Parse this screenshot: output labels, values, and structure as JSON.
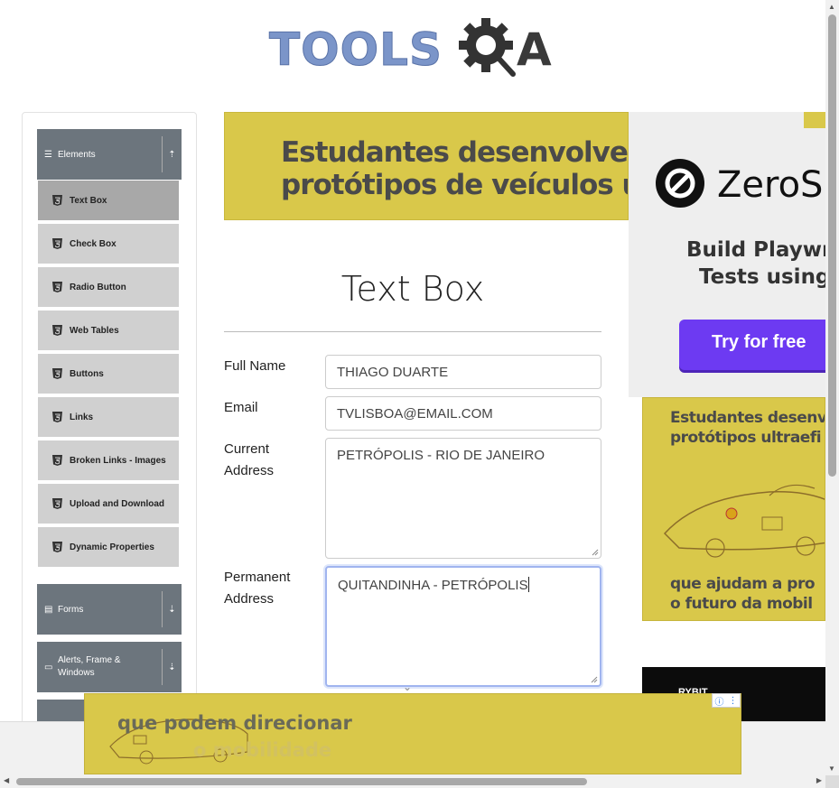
{
  "header": {
    "logo_part1": "TOOLS",
    "logo_part2": "A",
    "logo_icon": "gear-search-icon"
  },
  "sidebar": {
    "groups": [
      {
        "label": "Elements",
        "icon": "hamburger-icon",
        "chevron": "chevron-up-icon"
      },
      {
        "label": "Forms",
        "icon": "document-icon",
        "chevron": "chevron-down-icon"
      },
      {
        "label": "Alerts, Frame & Windows",
        "icon": "window-icon",
        "chevron": "chevron-down-icon"
      }
    ],
    "items": [
      {
        "label": "Text Box",
        "active": true
      },
      {
        "label": "Check Box"
      },
      {
        "label": "Radio Button"
      },
      {
        "label": "Web Tables"
      },
      {
        "label": "Buttons"
      },
      {
        "label": "Links"
      },
      {
        "label": "Broken Links - Images"
      },
      {
        "label": "Upload and Download"
      },
      {
        "label": "Dynamic Properties"
      }
    ]
  },
  "banner_ad": {
    "line1": "Estudantes desenvolvem",
    "line2": "protótipos de veículos ultr"
  },
  "main": {
    "title": "Text Box",
    "fields": {
      "full_name": {
        "label": "Full Name",
        "value": "THIAGO DUARTE"
      },
      "email": {
        "label": "Email",
        "value": "TVLISBOA@EMAIL.COM"
      },
      "current_address": {
        "label_line1": "Current",
        "label_line2": "Address",
        "value": "PETRÓPOLIS - RIO DE JANEIRO"
      },
      "permanent_address": {
        "label_line1": "Permanent",
        "label_line2": "Address",
        "value": "QUITANDINHA - PETRÓPOLIS"
      }
    }
  },
  "right_ad": {
    "brand": "ZeroS",
    "line1": "Build Playwr",
    "line2": "Tests using",
    "button": "Try for free",
    "accent": "#6d3af2"
  },
  "right_ad2": {
    "line1": "Estudantes desenv",
    "line2": "protótipos ultraefi",
    "line3": "que ajudam a pro",
    "line4": "o futuro da mobil"
  },
  "right_dark": {
    "text": "RYBIT"
  },
  "bottom_ad": {
    "line1": "que podem direcionar",
    "line2": "o mobilidade",
    "choices_info": "ⓘ",
    "choices_menu": "⋮"
  },
  "colors": {
    "ad_yellow": "#d9c84a",
    "nav_gray": "#6c757d",
    "logo_blue": "#7b95c9"
  }
}
